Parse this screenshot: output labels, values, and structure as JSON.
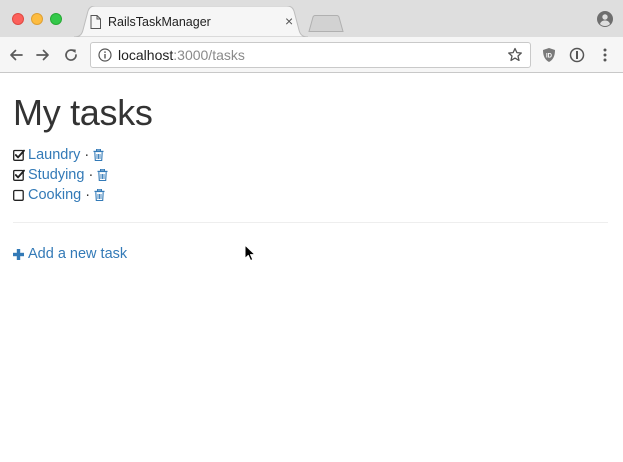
{
  "browser": {
    "tab": {
      "title": "RailsTaskManager",
      "close_glyph": "×"
    },
    "address": {
      "host": "localhost",
      "path": ":3000/tasks"
    },
    "icons": {
      "back": "back-arrow-icon",
      "forward": "forward-arrow-icon",
      "reload": "reload-icon",
      "info": "info-icon",
      "bookmark": "star-icon",
      "extension1": "ublock-shield-icon",
      "extension2": "extension-circle-icon",
      "menu": "kebab-menu-icon",
      "profile": "profile-icon"
    }
  },
  "page": {
    "title": "My tasks",
    "separator": "·",
    "tasks": [
      {
        "name": "Laundry",
        "done": true
      },
      {
        "name": "Studying",
        "done": true
      },
      {
        "name": "Cooking",
        "done": false
      }
    ],
    "add_task_label": "Add a new task"
  },
  "colors": {
    "link": "#337ab7",
    "text": "#333333",
    "divider": "#eeeeee"
  }
}
